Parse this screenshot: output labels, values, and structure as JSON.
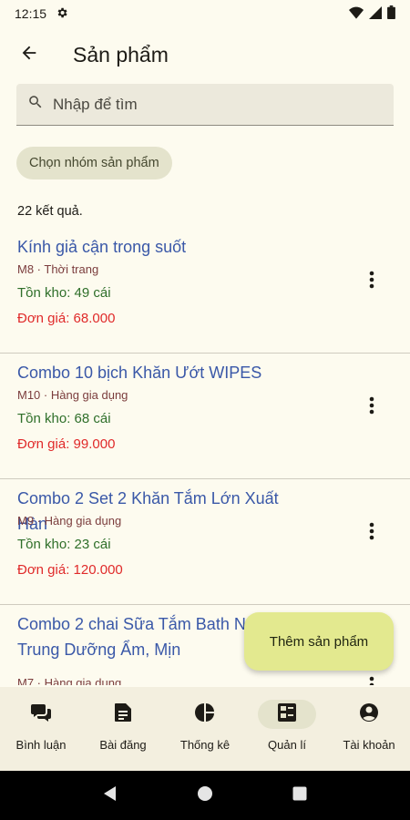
{
  "status": {
    "time": "12:15"
  },
  "header": {
    "title": "Sản phẩm"
  },
  "search": {
    "placeholder": "Nhập để tìm"
  },
  "filter_chip": {
    "label": "Chọn nhóm sản phẩm"
  },
  "results": {
    "count_text": "22 kết quả."
  },
  "products": [
    {
      "name": "Kính giả cận trong suốt",
      "meta": "M8 · Thời trang",
      "stock": "Tồn kho: 49 cái",
      "price": "Đơn giá: 68.000"
    },
    {
      "name": "Combo 10 bịch Khăn Ướt WIPES",
      "meta": "M10 · Hàng gia dụng",
      "stock": "Tồn kho: 68 cái",
      "price": "Đơn giá: 99.000"
    },
    {
      "name": "Combo 2 Set 2 Khăn Tắm Lớn Xuất Hàn",
      "meta": "M9 · Hàng gia dụng",
      "stock": "Tồn kho: 23 cái",
      "price": "Đơn giá: 120.000"
    },
    {
      "name": "Combo 2 chai Sữa Tắm Bath Nội Địa Trung Dưỡng Ẩm, Mịn",
      "meta": "M7 · Hàng gia dụng",
      "stock": "",
      "price": ""
    }
  ],
  "fab": {
    "label": "Thêm sản phẩm"
  },
  "bottom_nav": [
    {
      "label": "Bình luận",
      "icon": "comments-icon",
      "active": false
    },
    {
      "label": "Bài đăng",
      "icon": "post-icon",
      "active": false
    },
    {
      "label": "Thống kê",
      "icon": "pie-chart-icon",
      "active": false
    },
    {
      "label": "Quản lí",
      "icon": "manage-icon",
      "active": true
    },
    {
      "label": "Tài khoản",
      "icon": "account-icon",
      "active": false
    }
  ],
  "colors": {
    "background": "#fdfbef",
    "product_name": "#3a58a8",
    "stock": "#2f6f2a",
    "price": "#e02a2a",
    "fab": "#e3e98f"
  }
}
